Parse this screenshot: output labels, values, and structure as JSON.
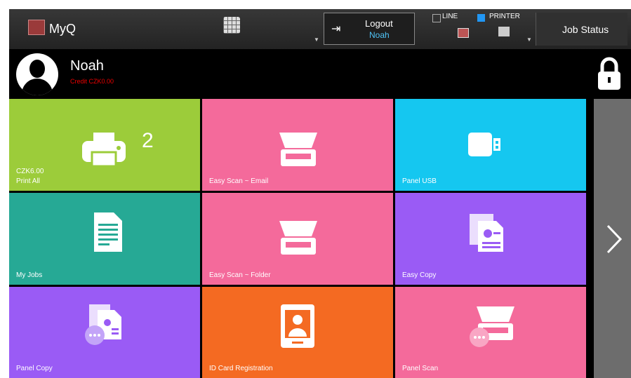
{
  "header": {
    "app_name": "MyQ",
    "logout_label": "Logout",
    "logout_user": "Noah",
    "line_label": "LINE",
    "printer_label": "PRINTER",
    "job_status_label": "Job Status"
  },
  "user": {
    "name": "Noah",
    "credit": "Credit CZK0.00"
  },
  "tiles": [
    {
      "label": "Print All",
      "sublabel": "CZK6.00",
      "count": "2",
      "color": "#9ccc3a"
    },
    {
      "label": "Easy Scan ~ Email",
      "color": "#f46a9b"
    },
    {
      "label": "Panel USB",
      "color": "#15c7f0"
    },
    {
      "label": "My Jobs",
      "color": "#26a995"
    },
    {
      "label": "Easy Scan ~ Folder",
      "color": "#f46a9b"
    },
    {
      "label": "Easy Copy",
      "color": "#9a5bf5"
    },
    {
      "label": "Panel Copy",
      "color": "#9a5bf5"
    },
    {
      "label": "ID Card Registration",
      "color": "#f46a22"
    },
    {
      "label": "Panel Scan",
      "color": "#f46a9b"
    }
  ]
}
